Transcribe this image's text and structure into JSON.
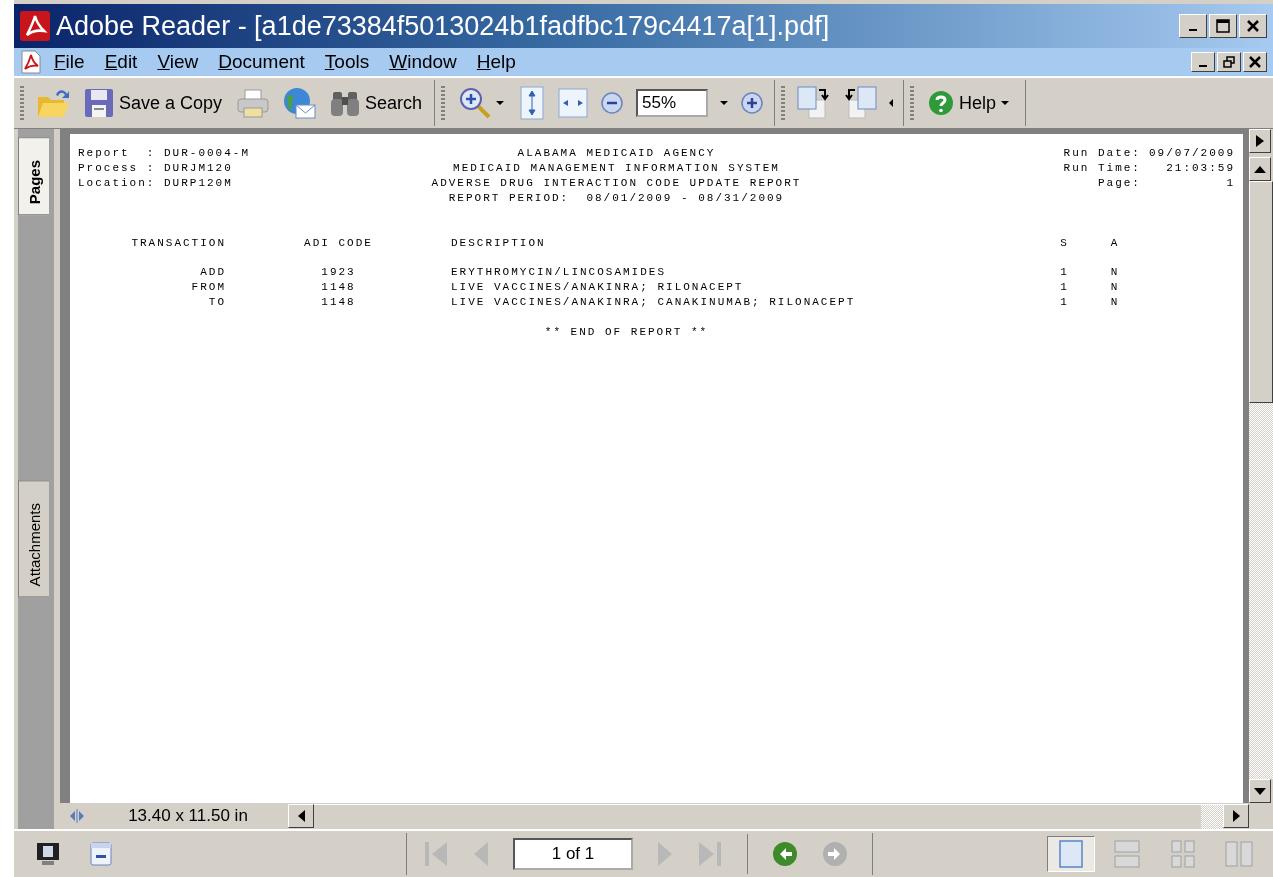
{
  "window": {
    "title": "Adobe Reader - [a1de73384f5013024b1fadfbc179c4417a[1].pdf]"
  },
  "menu": [
    "File",
    "Edit",
    "View",
    "Document",
    "Tools",
    "Window",
    "Help"
  ],
  "toolbar": {
    "save_label": "Save a Copy",
    "search_label": "Search",
    "zoom": "55%",
    "help_label": "Help"
  },
  "side_tabs": [
    {
      "label": "Pages",
      "selected": true
    },
    {
      "label": "Attachments",
      "selected": false
    }
  ],
  "report": {
    "header_left": [
      "Report  : DUR-0004-M",
      "Process : DURJM120",
      "Location: DURP120M"
    ],
    "header_center": [
      "ALABAMA MEDICAID AGENCY",
      "MEDICAID MANAGEMENT INFORMATION SYSTEM",
      "ADVERSE DRUG INTERACTION CODE UPDATE REPORT",
      "REPORT PERIOD:  08/01/2009 - 08/31/2009"
    ],
    "header_right": [
      {
        "label": "Run Date:",
        "value": "09/07/2009"
      },
      {
        "label": "Run Time:",
        "value": "21:03:59"
      },
      {
        "label": "Page:",
        "value": "1"
      }
    ],
    "columns": [
      "TRANSACTION",
      "ADI CODE",
      "DESCRIPTION",
      "S",
      "A"
    ],
    "rows": [
      [
        "ADD",
        "1923",
        "ERYTHROMYCIN/LINCOSAMIDES",
        "1",
        "N"
      ],
      [
        "FROM",
        "1148",
        "LIVE VACCINES/ANAKINRA; RILONACEPT",
        "1",
        "N"
      ],
      [
        "TO",
        "1148",
        "LIVE VACCINES/ANAKINRA; CANAKINUMAB; RILONACEPT",
        "1",
        "N"
      ]
    ],
    "footer": "** END OF REPORT **"
  },
  "page_size": "13.40 x 11.50 in",
  "page_field": "1 of 1",
  "nav": [
    {
      "kind": "first",
      "disabled": true
    },
    {
      "kind": "prev",
      "disabled": true
    },
    {
      "kind": "field"
    },
    {
      "kind": "next",
      "disabled": true
    },
    {
      "kind": "last",
      "disabled": true
    },
    {
      "kind": "back",
      "disabled": false
    },
    {
      "kind": "forward",
      "disabled": true
    }
  ],
  "view_modes": [
    {
      "kind": "single",
      "selected": true
    },
    {
      "kind": "continuous",
      "selected": false
    },
    {
      "kind": "grid",
      "selected": false
    },
    {
      "kind": "facing",
      "selected": false
    }
  ]
}
